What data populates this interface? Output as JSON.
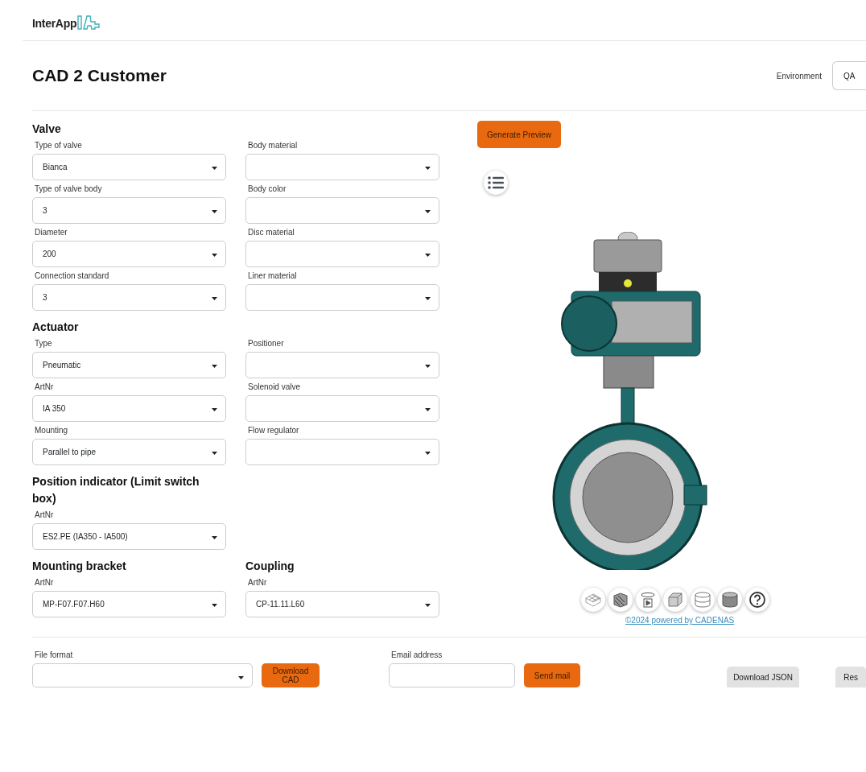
{
  "header": {
    "logo_text": "InterApp"
  },
  "title": "CAD 2 Customer",
  "environment": {
    "label": "Environment",
    "value": "QA"
  },
  "sections": [
    {
      "title": "Valve",
      "fields": [
        {
          "label": "Type of valve",
          "value": "Bianca"
        },
        {
          "label": "Body material"
        },
        {
          "label": "Type of valve body",
          "value": "3"
        },
        {
          "label": "Body color"
        },
        {
          "label": "Diameter",
          "value": "200"
        },
        {
          "label": "Disc material"
        },
        {
          "label": "Connection standard",
          "value": "3"
        },
        {
          "label": "Liner material"
        }
      ]
    },
    {
      "title": "Actuator",
      "fields": [
        {
          "label": "Type",
          "value": "Pneumatic"
        },
        {
          "label": "Positioner"
        },
        {
          "label": "ArtNr",
          "value": "IA 350"
        },
        {
          "label": "Solenoid valve"
        },
        {
          "label": "Mounting",
          "value": "Parallel to pipe"
        },
        {
          "label": "Flow regulator"
        }
      ]
    },
    {
      "title": "Position indicator (Limit switch box)",
      "fields": [
        {
          "label": "ArtNr",
          "value": "ES2.PE (IA350 - IA500)"
        }
      ]
    }
  ],
  "paired_sections": [
    {
      "title": "Mounting bracket",
      "fields": [
        {
          "label": "ArtNr",
          "value": "MP-F07.F07.H60"
        }
      ]
    },
    {
      "title": "Coupling",
      "fields": [
        {
          "label": "ArtNr",
          "value": "CP-11.11.L60"
        }
      ]
    }
  ],
  "preview": {
    "button": "Generate Preview",
    "credit": "©2024 powered by CADENAS"
  },
  "footer": {
    "file_format": {
      "label": "File format"
    },
    "download_cad": "Download CAD",
    "email": {
      "label": "Email address"
    },
    "send_mail": "Send mail",
    "download_json": "Download JSON",
    "reset": "Res"
  }
}
